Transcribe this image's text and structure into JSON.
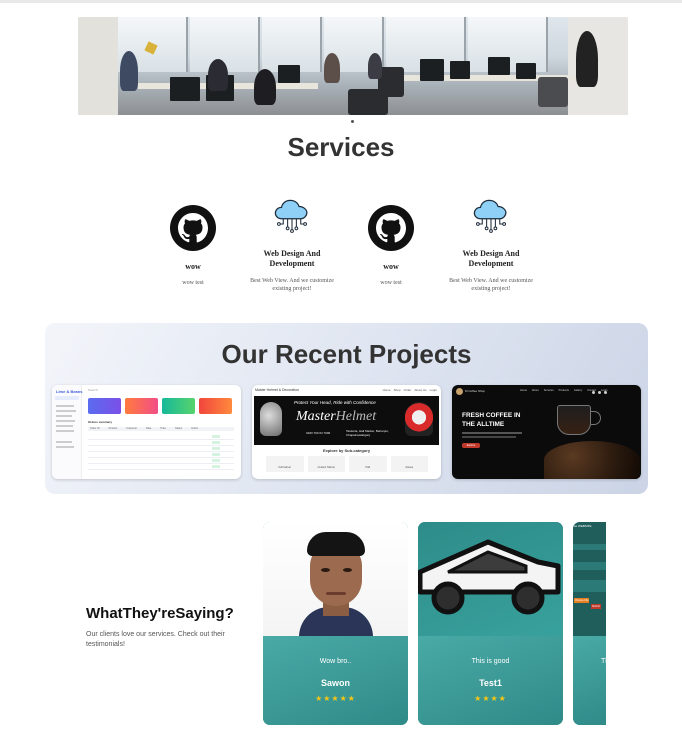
{
  "services": {
    "title": "Services",
    "items": [
      {
        "icon": "github-icon",
        "title": "wow",
        "desc": "wow test"
      },
      {
        "icon": "cloud-circuit-icon",
        "title": "Web Design And Development",
        "desc": "Best Web View. And we customize existing project!"
      },
      {
        "icon": "github-icon",
        "title": "wow",
        "desc": "wow test"
      },
      {
        "icon": "cloud-circuit-icon",
        "title": "Web Design And Development",
        "desc": "Best Web View. And we customize existing project!"
      }
    ]
  },
  "projects": {
    "title": "Our Recent Projects",
    "helmet": {
      "store": "Master Helmet & Decoration",
      "tagline": "Protect Your Head, Ride with Confidence",
      "brand_a": "Master",
      "brand_b": "Helmet",
      "phone": "0183 700 64 7096",
      "address": "Tatuleria, Hall Market, Beharpur, Chapainawabganj",
      "explore": "Explore by Sub-category",
      "nav": [
        "Home",
        "Shop",
        "Order",
        "About Us",
        "Login"
      ],
      "subs": [
        "Full helmet",
        "Custom Helmet",
        "Half",
        "Gloves"
      ]
    },
    "coffee": {
      "brand": "M Coffee Shop",
      "heading_line1": "FRESH COFFEE IN",
      "heading_line2": "THE ALLTIME",
      "nav": [
        "Home",
        "About",
        "Services",
        "Products",
        "Gallery",
        "Contact",
        "Login"
      ],
      "button": "Explore"
    },
    "dashboard": {
      "brand": "Lime & Beans",
      "search": "Search",
      "table_title": "Orders summary",
      "headers": [
        "Order ID",
        "Product",
        "Customer",
        "Date",
        "Price",
        "Status",
        "Action"
      ]
    }
  },
  "testimonials": {
    "title": "WhatThey'reSaying?",
    "subtitle": "Our clients love our services. Check out their testimonials!",
    "cards": [
      {
        "quote": "Wow bro..",
        "name": "Sawon",
        "stars": "★★★★★"
      },
      {
        "quote": "This is good",
        "name": "Test1",
        "stars": "★★★★"
      },
      {
        "quote": "Th",
        "name": "",
        "stars": ""
      }
    ],
    "partial_ui": {
      "header": "se WEBSITE",
      "button_a": "Choose File",
      "button_b": "Submit"
    }
  },
  "colors": {
    "teal_card": "#3a9b98",
    "star": "#f5c518",
    "heading": "#333333"
  }
}
